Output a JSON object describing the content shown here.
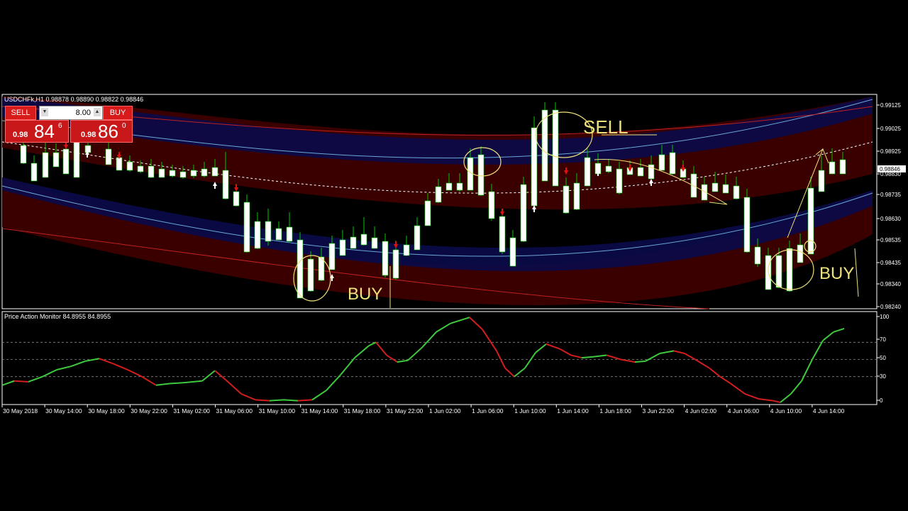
{
  "symbol_bar": {
    "symbol": "USDCHFk,H1",
    "ohlc": "0.98878 0.98890 0.98822 0.98846"
  },
  "one_click_trading": {
    "sell_label": "SELL",
    "buy_label": "BUY",
    "lot_size": "8.00",
    "sell_price_prefix": "0.98",
    "sell_price_big": "84",
    "sell_price_sup": "6",
    "buy_price_prefix": "0.98",
    "buy_price_big": "86",
    "buy_price_sup": "0"
  },
  "price_axis": {
    "labels": [
      "0.99125",
      "0.99025",
      "0.98925",
      "0.98830",
      "0.98735",
      "0.98630",
      "0.98535",
      "0.98435",
      "0.98340",
      "0.98240"
    ],
    "current_price": "0.98846"
  },
  "oscillator": {
    "title": "Price Action Monitor 84.8955 84.8955",
    "levels": [
      "100",
      "70",
      "50",
      "30",
      "0"
    ]
  },
  "time_axis": {
    "labels": [
      "30 May 2018",
      "30 May 14:00",
      "30 May 18:00",
      "30 May 22:00",
      "31 May 02:00",
      "31 May 06:00",
      "31 May 10:00",
      "31 May 14:00",
      "31 May 18:00",
      "31 May 22:00",
      "1 Jun 02:00",
      "1 Jun 06:00",
      "1 Jun 10:00",
      "1 Jun 14:00",
      "1 Jun 18:00",
      "3 Jun 22:00",
      "4 Jun 02:00",
      "4 Jun 06:00",
      "4 Jun 10:00",
      "4 Jun 14:00"
    ]
  },
  "annotations": {
    "sell_text": "SELL",
    "buy_text_1": "BUY",
    "buy_text_2": "BUY"
  },
  "colors": {
    "bull_candle": "#ffffff",
    "bear_candle": "#ffffff",
    "wick": "#00c800",
    "band_outer": "#3a0000",
    "band_inner": "#0a0a4a",
    "osc_up": "#3ec93e",
    "osc_down": "#d21e1e",
    "annotation": "#f0e27a"
  }
}
